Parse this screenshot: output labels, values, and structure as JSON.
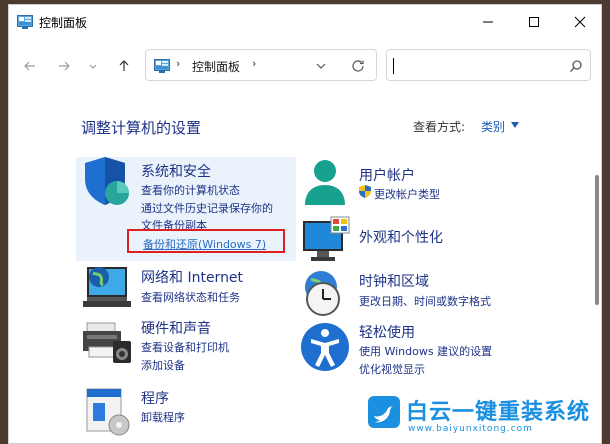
{
  "window": {
    "title": "控制面板"
  },
  "address": {
    "separator": "›",
    "path": "控制面板"
  },
  "search": {
    "value": "",
    "placeholder": ""
  },
  "content": {
    "heading": "调整计算机的设置",
    "view_label": "查看方式:",
    "view_value": "类别"
  },
  "categories": [
    {
      "title": "系统和安全",
      "links": [
        "查看你的计算机状态",
        "通过文件历史记录保存你的",
        "文件备份副本",
        "备份和还原(Windows 7)"
      ]
    },
    {
      "title": "网络和 Internet",
      "links": [
        "查看网络状态和任务"
      ]
    },
    {
      "title": "硬件和声音",
      "links": [
        "查看设备和打印机",
        "添加设备"
      ]
    },
    {
      "title": "程序",
      "links": [
        "卸载程序"
      ]
    },
    {
      "title": "用户帐户",
      "links": [
        "更改帐户类型"
      ]
    },
    {
      "title": "外观和个性化",
      "links": []
    },
    {
      "title": "时钟和区域",
      "links": [
        "更改日期、时间或数字格式"
      ]
    },
    {
      "title": "轻松使用",
      "links": [
        "使用 Windows 建议的设置",
        "优化视觉显示"
      ]
    }
  ],
  "watermark": {
    "text": "白云一键重装系统",
    "url": "www.baiyunxitong.com"
  },
  "colors": {
    "link": "#1e3287",
    "accent": "#1a5fb4",
    "highlight": "#eaf3fb",
    "redbox": "#e02020"
  }
}
